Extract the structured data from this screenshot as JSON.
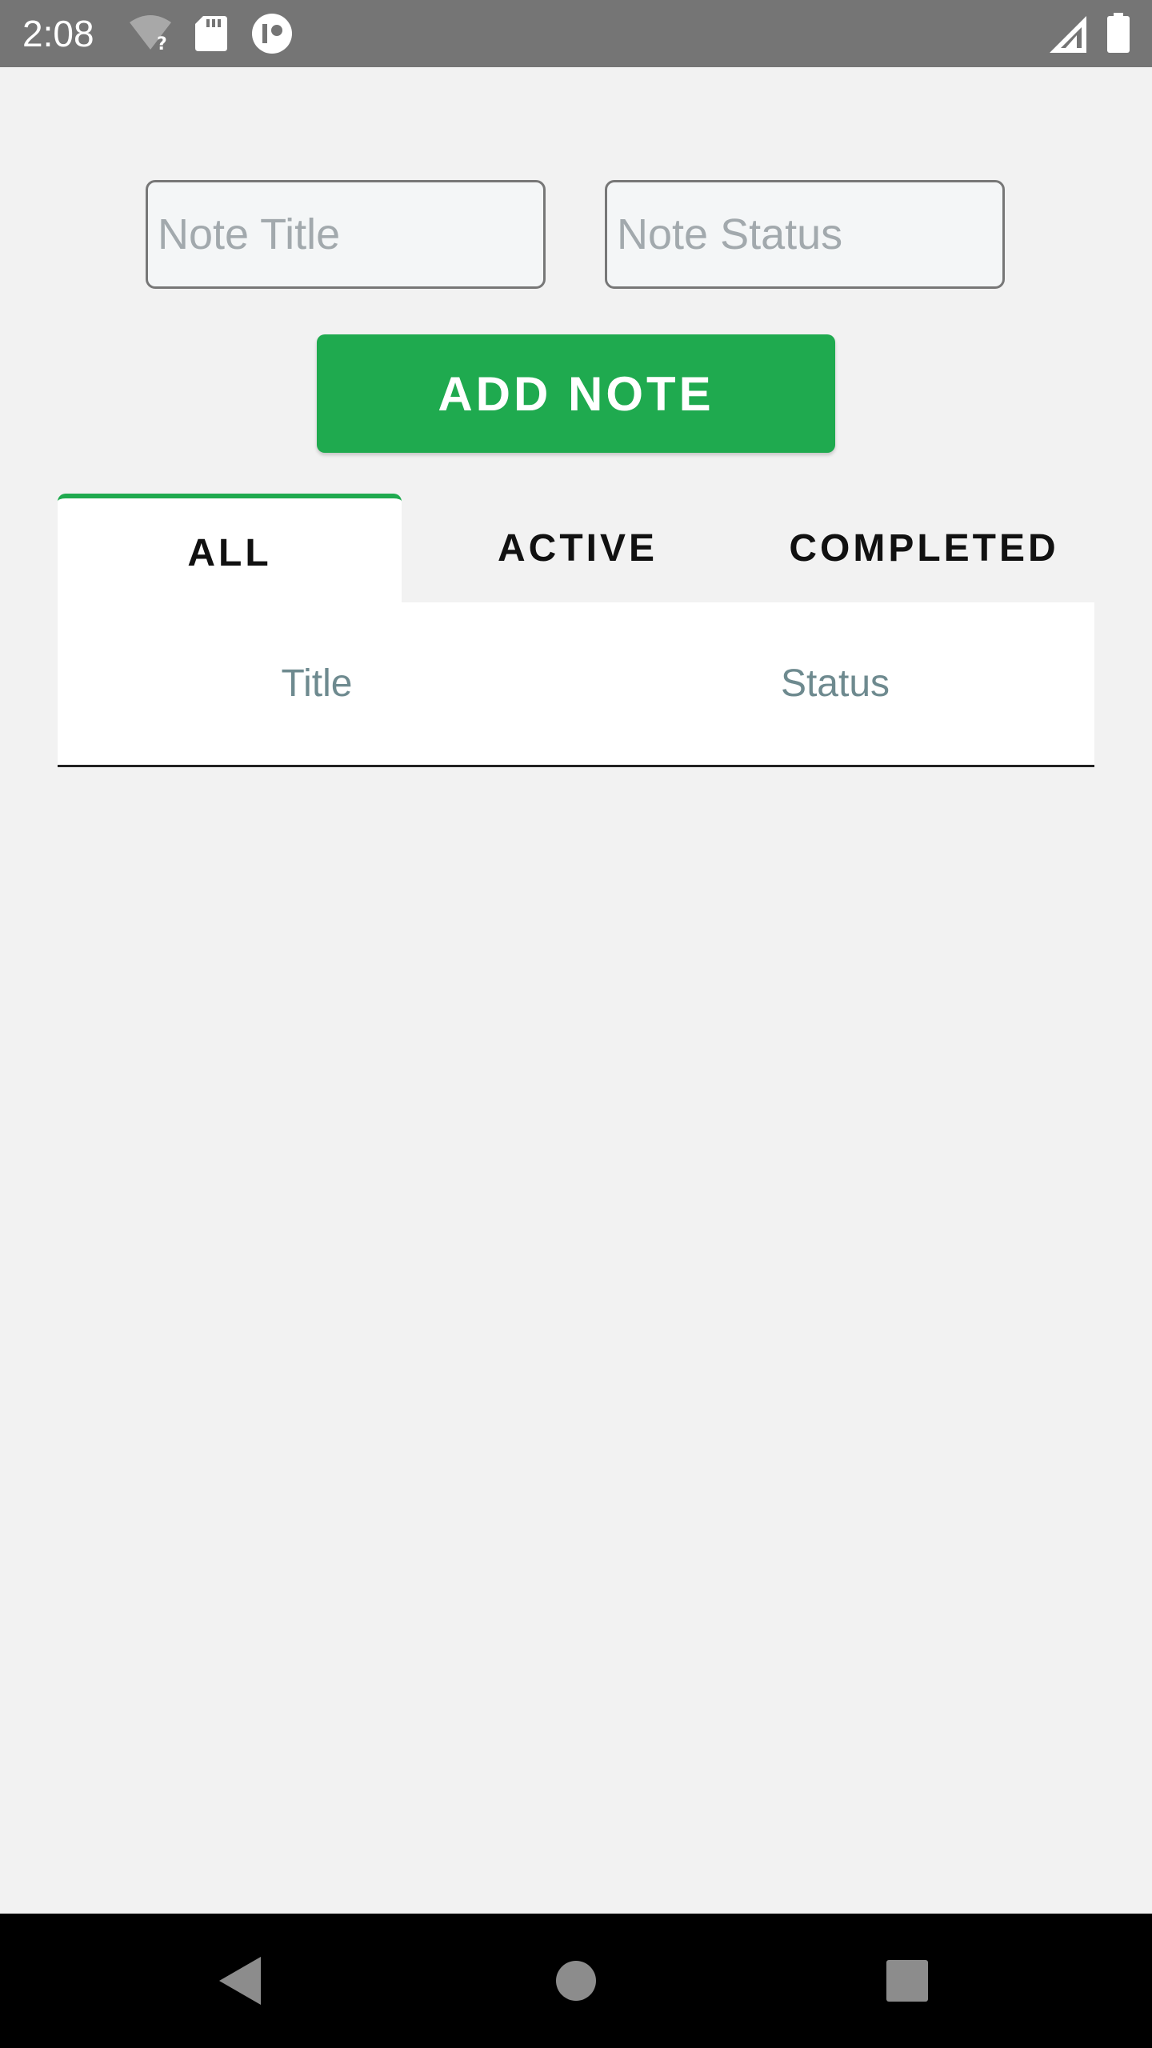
{
  "status_bar": {
    "time": "2:08",
    "icons": [
      "wifi-unknown-icon",
      "sd-card-icon",
      "app-notification-icon",
      "cellular-signal-icon",
      "battery-icon"
    ]
  },
  "form": {
    "title_placeholder": "Note Title",
    "status_placeholder": "Note Status",
    "title_value": "",
    "status_value": "",
    "add_button_label": "ADD NOTE"
  },
  "tabs": [
    {
      "label": "ALL",
      "selected": true
    },
    {
      "label": "ACTIVE",
      "selected": false
    },
    {
      "label": "COMPLETED",
      "selected": false
    }
  ],
  "table": {
    "columns": [
      "Title",
      "Status"
    ],
    "rows": []
  },
  "nav_bar": {
    "icons": [
      "back-icon",
      "home-icon",
      "recents-icon"
    ]
  },
  "colors": {
    "accent": "#1faa4f",
    "status_bar": "#757575",
    "background": "#f2f2f2",
    "header_text": "#6e8a8f"
  }
}
